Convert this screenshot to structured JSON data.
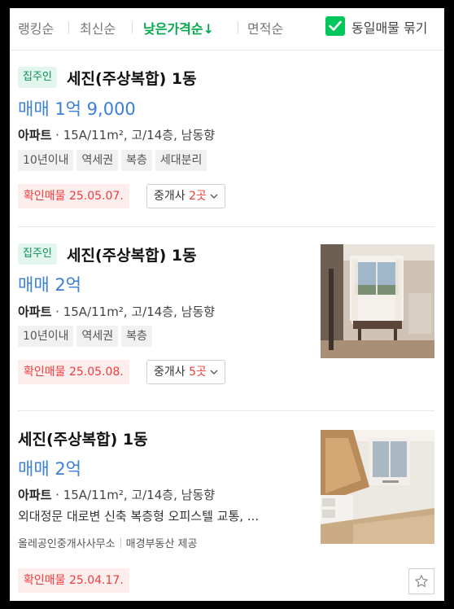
{
  "sort": {
    "items": [
      "랭킹순",
      "최신순",
      "낮은가격순↓",
      "면적순"
    ],
    "active_index": 2,
    "same_listing_label": "동일매물 묶기",
    "same_listing_checked": true
  },
  "listings": [
    {
      "badge": "집주인",
      "title": "세진(주상복합) 1동",
      "price": "매매 1억 9,000",
      "type": "아파트",
      "spec": "15A/11m², 고/14층, 남동향",
      "tags": [
        "10년이내",
        "역세권",
        "복층",
        "세대분리"
      ],
      "confirm": "확인매물 25.05.07.",
      "agent_prefix": "중개사 ",
      "agent_count": "2곳",
      "has_photo": false
    },
    {
      "badge": "집주인",
      "title": "세진(주상복합) 1동",
      "price": "매매 2억",
      "type": "아파트",
      "spec": "15A/11m², 고/14층, 남동향",
      "tags": [
        "10년이내",
        "역세권",
        "복층"
      ],
      "confirm": "확인매물 25.05.08.",
      "agent_prefix": "중개사 ",
      "agent_count": "5곳",
      "has_photo": true
    },
    {
      "title": "세진(주상복합) 1동",
      "price": "매매 2억",
      "type": "아파트",
      "spec": "15A/11m², 고/14층, 남동향",
      "description": "외대정문 대로변 신축 복층형 오피스텔 교통, ...",
      "broker": "올레공인중개사사무소",
      "provider": "매경부동산 제공",
      "confirm": "확인매물 25.04.17.",
      "has_photo": true
    }
  ],
  "colors": {
    "accent_green": "#03c75a",
    "price_blue": "#3a7fd8",
    "confirm_red": "#f03b3b"
  }
}
